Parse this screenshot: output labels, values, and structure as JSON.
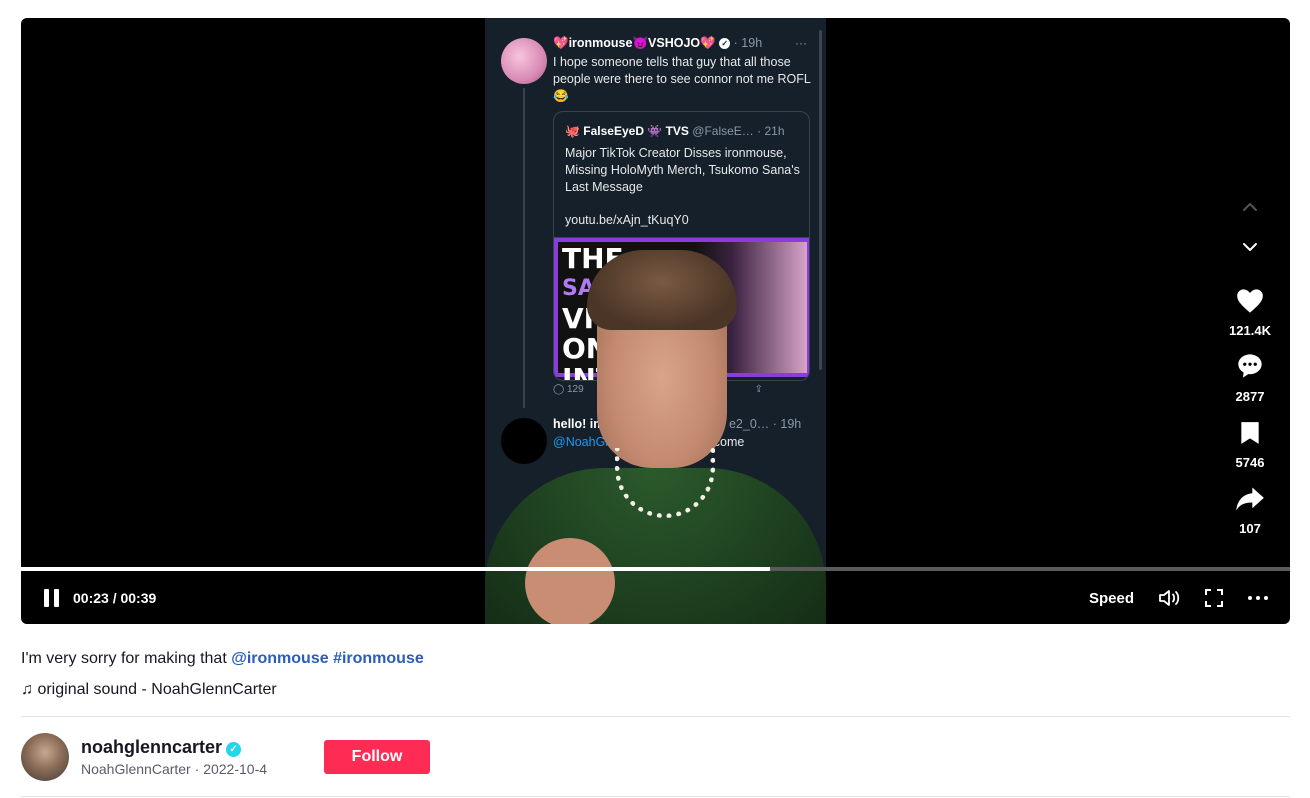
{
  "video": {
    "tweet": {
      "author": "💖ironmouse😈VSHOJO💖",
      "verified_mark": "✓",
      "time": "· 19h",
      "menu": "···",
      "text": "I hope someone tells that guy that all those people were there to see connor not me ROFL 😂"
    },
    "quote": {
      "author": "🐙 FalseEyeD 👾 TVS",
      "handle": "@FalseE… · 21h",
      "text": "Major TikTok Creator Disses ironmouse, Missing HoloMyth Merch, Tsukomo Sana's Last Message",
      "link": "youtu.be/xAjn_tKuqY0",
      "thumb_line1": "THE",
      "thumb_line2": "SADD",
      "thumb_line3": "VI",
      "thumb_line4": "ON",
      "thumb_line5": "INT"
    },
    "tweet_actions": {
      "replies": "129"
    },
    "reply": {
      "author": "hello! im d",
      "meta": "e2_0… · 19h",
      "mention": "@NoahGl",
      "text_rest": "elcome"
    }
  },
  "player": {
    "current_time": "00:23",
    "separator": " / ",
    "duration": "00:39",
    "progress": 0.59,
    "speed_label": "Speed"
  },
  "actions": {
    "likes": "121.4K",
    "comments": "2877",
    "saves": "5746",
    "shares": "107"
  },
  "post": {
    "caption_text": "I'm very sorry for making that ",
    "mention": "@ironmouse",
    "hashtag": "#ironmouse",
    "music_icon": "♫",
    "sound": "original sound - NoahGlennCarter"
  },
  "author": {
    "username": "noahglenncarter",
    "verified_mark": "✓",
    "nickname": "NoahGlennCarter",
    "date_separator": " · ",
    "date": "2022-10-4",
    "follow_label": "Follow"
  },
  "colors": {
    "accent": "#fe2c55",
    "link": "#2b5db9",
    "verified": "#20d5ec"
  }
}
